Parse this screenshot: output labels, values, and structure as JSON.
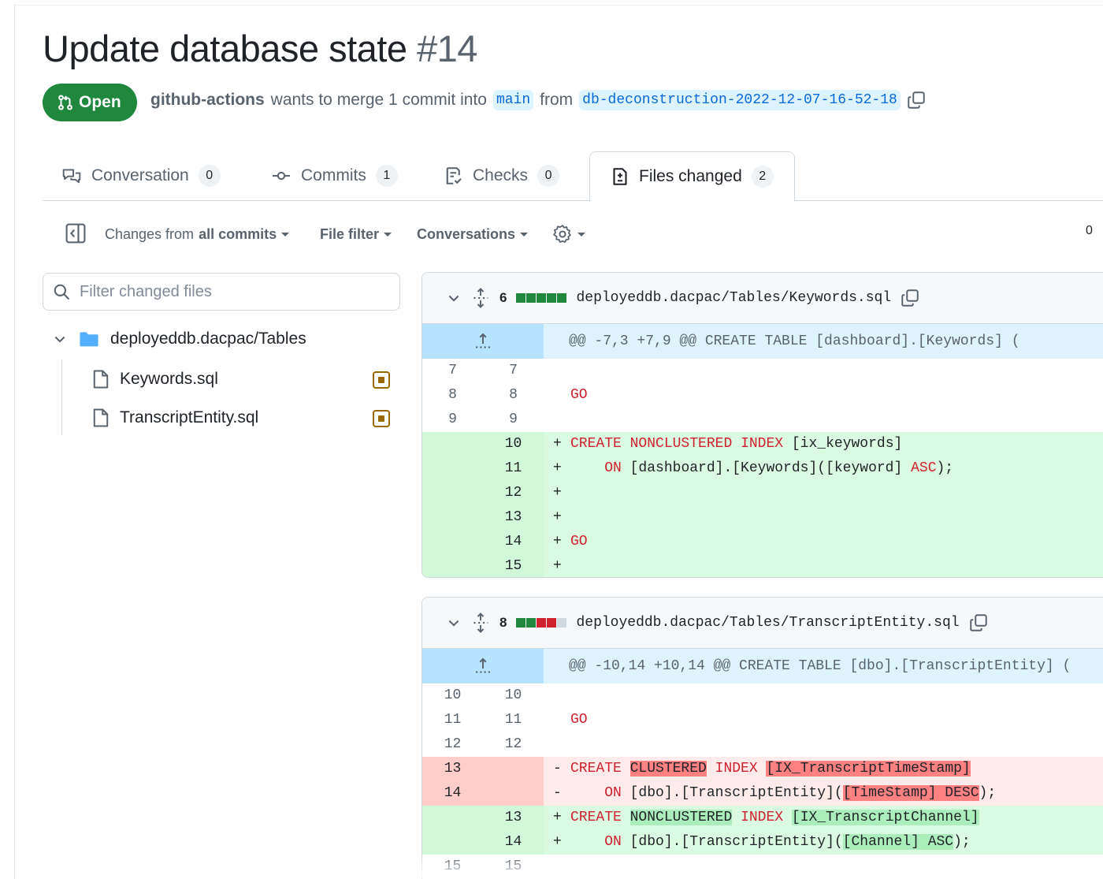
{
  "pr": {
    "title": "Update database state",
    "number": "#14",
    "state": "Open",
    "author": "github-actions",
    "merge_text": "wants to merge 1 commit into",
    "base_branch": "main",
    "from_text": "from",
    "head_branch": "db-deconstruction-2022-12-07-16-52-18"
  },
  "tabs": [
    {
      "label": "Conversation",
      "count": "0"
    },
    {
      "label": "Commits",
      "count": "1"
    },
    {
      "label": "Checks",
      "count": "0"
    },
    {
      "label": "Files changed",
      "count": "2",
      "selected": true
    }
  ],
  "toolbar": {
    "changes_prefix": "Changes from",
    "changes_value": "all commits",
    "file_filter": "File filter",
    "conversations": "Conversations",
    "right_count": "0"
  },
  "sidebar": {
    "filter_placeholder": "Filter changed files",
    "directory": "deployeddb.dacpac/Tables",
    "files": [
      "Keywords.sql",
      "TranscriptEntity.sql"
    ]
  },
  "diffs": [
    {
      "changes": "6",
      "path": "deployeddb.dacpac/Tables/Keywords.sql",
      "hunk": "@@ -7,3 +7,9 @@ CREATE TABLE [dashboard].[Keywords] (",
      "lines": [
        {
          "old": "7",
          "new": "7",
          "text": ""
        },
        {
          "old": "8",
          "new": "8",
          "text": "GO"
        },
        {
          "old": "9",
          "new": "9",
          "text": ""
        },
        {
          "new": "10",
          "sign": "+",
          "text": "CREATE NONCLUSTERED INDEX [ix_keywords]"
        },
        {
          "new": "11",
          "sign": "+",
          "text": "    ON [dashboard].[Keywords]([keyword] ASC);"
        },
        {
          "new": "12",
          "sign": "+",
          "text": ""
        },
        {
          "new": "13",
          "sign": "+",
          "text": ""
        },
        {
          "new": "14",
          "sign": "+",
          "text": "GO"
        },
        {
          "new": "15",
          "sign": "+",
          "text": ""
        }
      ]
    },
    {
      "changes": "8",
      "path": "deployeddb.dacpac/Tables/TranscriptEntity.sql",
      "hunk": "@@ -10,14 +10,14 @@ CREATE TABLE [dbo].[TranscriptEntity] (",
      "lines": [
        {
          "old": "10",
          "new": "10",
          "text": ""
        },
        {
          "old": "11",
          "new": "11",
          "text": "GO"
        },
        {
          "old": "12",
          "new": "12",
          "text": ""
        },
        {
          "old": "13",
          "sign": "-",
          "text": "CREATE CLUSTERED INDEX [IX_TranscriptTimeStamp]"
        },
        {
          "old": "14",
          "sign": "-",
          "text": "    ON [dbo].[TranscriptEntity]([TimeStamp] DESC);"
        },
        {
          "new": "13",
          "sign": "+",
          "text": "CREATE NONCLUSTERED INDEX [IX_TranscriptChannel]"
        },
        {
          "new": "14",
          "sign": "+",
          "text": "    ON [dbo].[TranscriptEntity]([Channel] ASC);"
        },
        {
          "old": "15",
          "new": "15",
          "text": ""
        }
      ]
    }
  ],
  "colors": {
    "open_green": "#1f883d",
    "link_blue": "#0969da",
    "add_bg": "#dafbe1",
    "del_bg": "#ffebe9",
    "hunk_bg": "#ddf4ff"
  }
}
